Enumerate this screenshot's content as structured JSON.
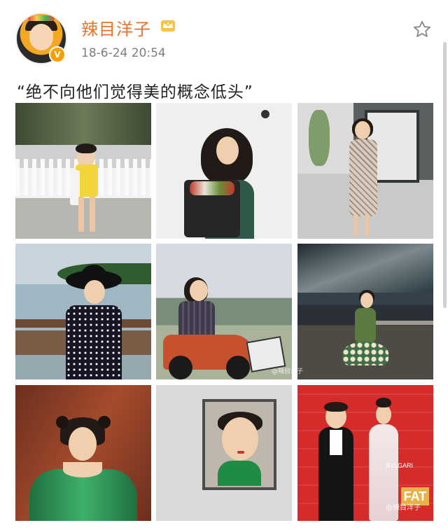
{
  "post": {
    "username": "辣目洋子",
    "timestamp": "18-6-24 20:54",
    "caption": "“绝不向他们觉得美的概念低头”",
    "verified_badge": "V",
    "favorite_icon": "star-icon",
    "member_icon": "crown-icon"
  },
  "photos": [
    {
      "id": "1",
      "scene": "girl-yellow-top-fence"
    },
    {
      "id": "2",
      "scene": "girl-holding-bouquet"
    },
    {
      "id": "3",
      "scene": "girl-plaid-dress-street"
    },
    {
      "id": "4",
      "scene": "girl-black-hat-lake"
    },
    {
      "id": "5",
      "scene": "girl-on-atv"
    },
    {
      "id": "6",
      "scene": "girl-flower-skirt-night"
    },
    {
      "id": "7",
      "scene": "girl-green-dress"
    },
    {
      "id": "8",
      "scene": "girl-framed-portrait"
    },
    {
      "id": "9",
      "scene": "red-carpet-event"
    }
  ],
  "overlays": {
    "red_carpet_logo": "FAT",
    "red_carpet_brand": "BVLGARI",
    "watermark_1": "@辣目洋子",
    "watermark_2": "@辣目洋子"
  },
  "colors": {
    "username": "#e8722a",
    "verified": "#f7a100",
    "timestamp": "#7d7d7d"
  }
}
